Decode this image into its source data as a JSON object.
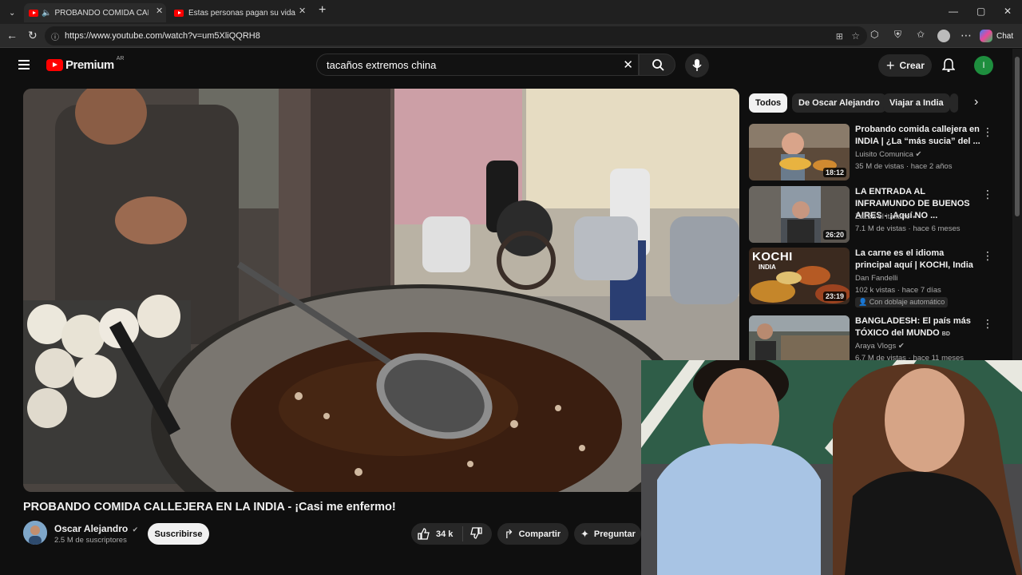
{
  "browser": {
    "tabs": [
      {
        "title": "PROBANDO COMIDA CALLEJE"
      },
      {
        "title": "Estas personas pagan su vida con c"
      }
    ],
    "url": "https://www.youtube.com/watch?v=um5XliQQRH8",
    "copilot_label": "Chat"
  },
  "youtube": {
    "logo": "Premium",
    "region": "AR",
    "search_query": "tacaños extremos china",
    "create_label": "Crear",
    "avatar_letter": "I"
  },
  "video": {
    "title": "PROBANDO COMIDA CALLEJERA EN LA INDIA - ¡Casi me enfermo!",
    "channel": "Oscar Alejandro",
    "subscribers": "2.5 M de suscriptores",
    "subscribe_label": "Suscribirse",
    "likes": "34 k",
    "share_label": "Compartir",
    "ask_label": "Preguntar"
  },
  "chips": [
    "Todos",
    "De Oscar Alejandro",
    "Viajar a India"
  ],
  "recommendations": [
    {
      "title": "Probando comida callejera en INDIA | ¿La “más sucia” del ...",
      "channel": "Luisito Comunica",
      "verified": true,
      "meta": "35 M de vistas · hace 2 años",
      "duration": "18:12"
    },
    {
      "title": "LA ENTRADA AL INFRAMUNDO DE BUENOS AIRES - ¡Aquí NO ...",
      "channel": "Zazza el italiano",
      "verified": true,
      "meta": "7.1 M de vistas · hace 6 meses",
      "duration": "26:20"
    },
    {
      "title": "La carne es el idioma principal aquí | KOCHI, India",
      "channel": "Dan Fandelli",
      "verified": false,
      "meta": "102 k vistas · hace 7 días",
      "duration": "23:19",
      "badge": "Con doblaje automático",
      "thumb_text": "KOCHI",
      "thumb_sub": "INDIA"
    },
    {
      "title": "BANGLADESH: El país más TÓXICO del MUNDO",
      "title_suffix": "BD",
      "channel": "Araya Vlogs",
      "verified": true,
      "meta": "6.7 M de vistas · hace 11 meses"
    }
  ]
}
